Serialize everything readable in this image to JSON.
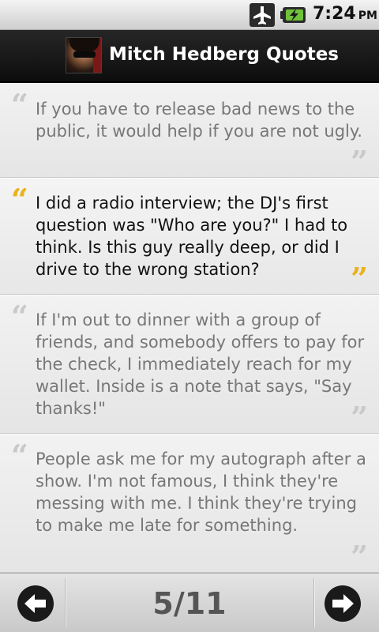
{
  "status_bar": {
    "time": "7:24",
    "ampm": "PM",
    "icons": [
      "airplane-mode-icon",
      "battery-charging-icon"
    ]
  },
  "header": {
    "title": "Mitch Hedberg Quotes",
    "avatar": "mitch-hedberg-avatar"
  },
  "quotes": [
    {
      "text": "If you have to release bad news to the public, it would help if you are not ugly.",
      "selected": false
    },
    {
      "text": "I did a radio interview; the DJ's first question was \"Who are you?\" I had to think. Is this guy really deep, or did I drive to the wrong station?",
      "selected": true
    },
    {
      "text": "If I'm out to dinner with a group of friends, and somebody offers to pay for the check, I immediately reach for my wallet. Inside is a note that says, \"Say thanks!\"",
      "selected": false
    },
    {
      "text": "People ask me for my autograph after a show. I'm not famous, I think they're messing with me. I think they're trying to make me late for something.",
      "selected": false
    }
  ],
  "quote_marks": {
    "open": "“",
    "close": "”"
  },
  "colors": {
    "highlight_quote_mark": "#e8b21c",
    "inactive_quote_mark": "#c9c9c9"
  },
  "nav": {
    "page_indicator": "5/11",
    "prev_icon": "arrow-left-icon",
    "next_icon": "arrow-right-icon"
  }
}
